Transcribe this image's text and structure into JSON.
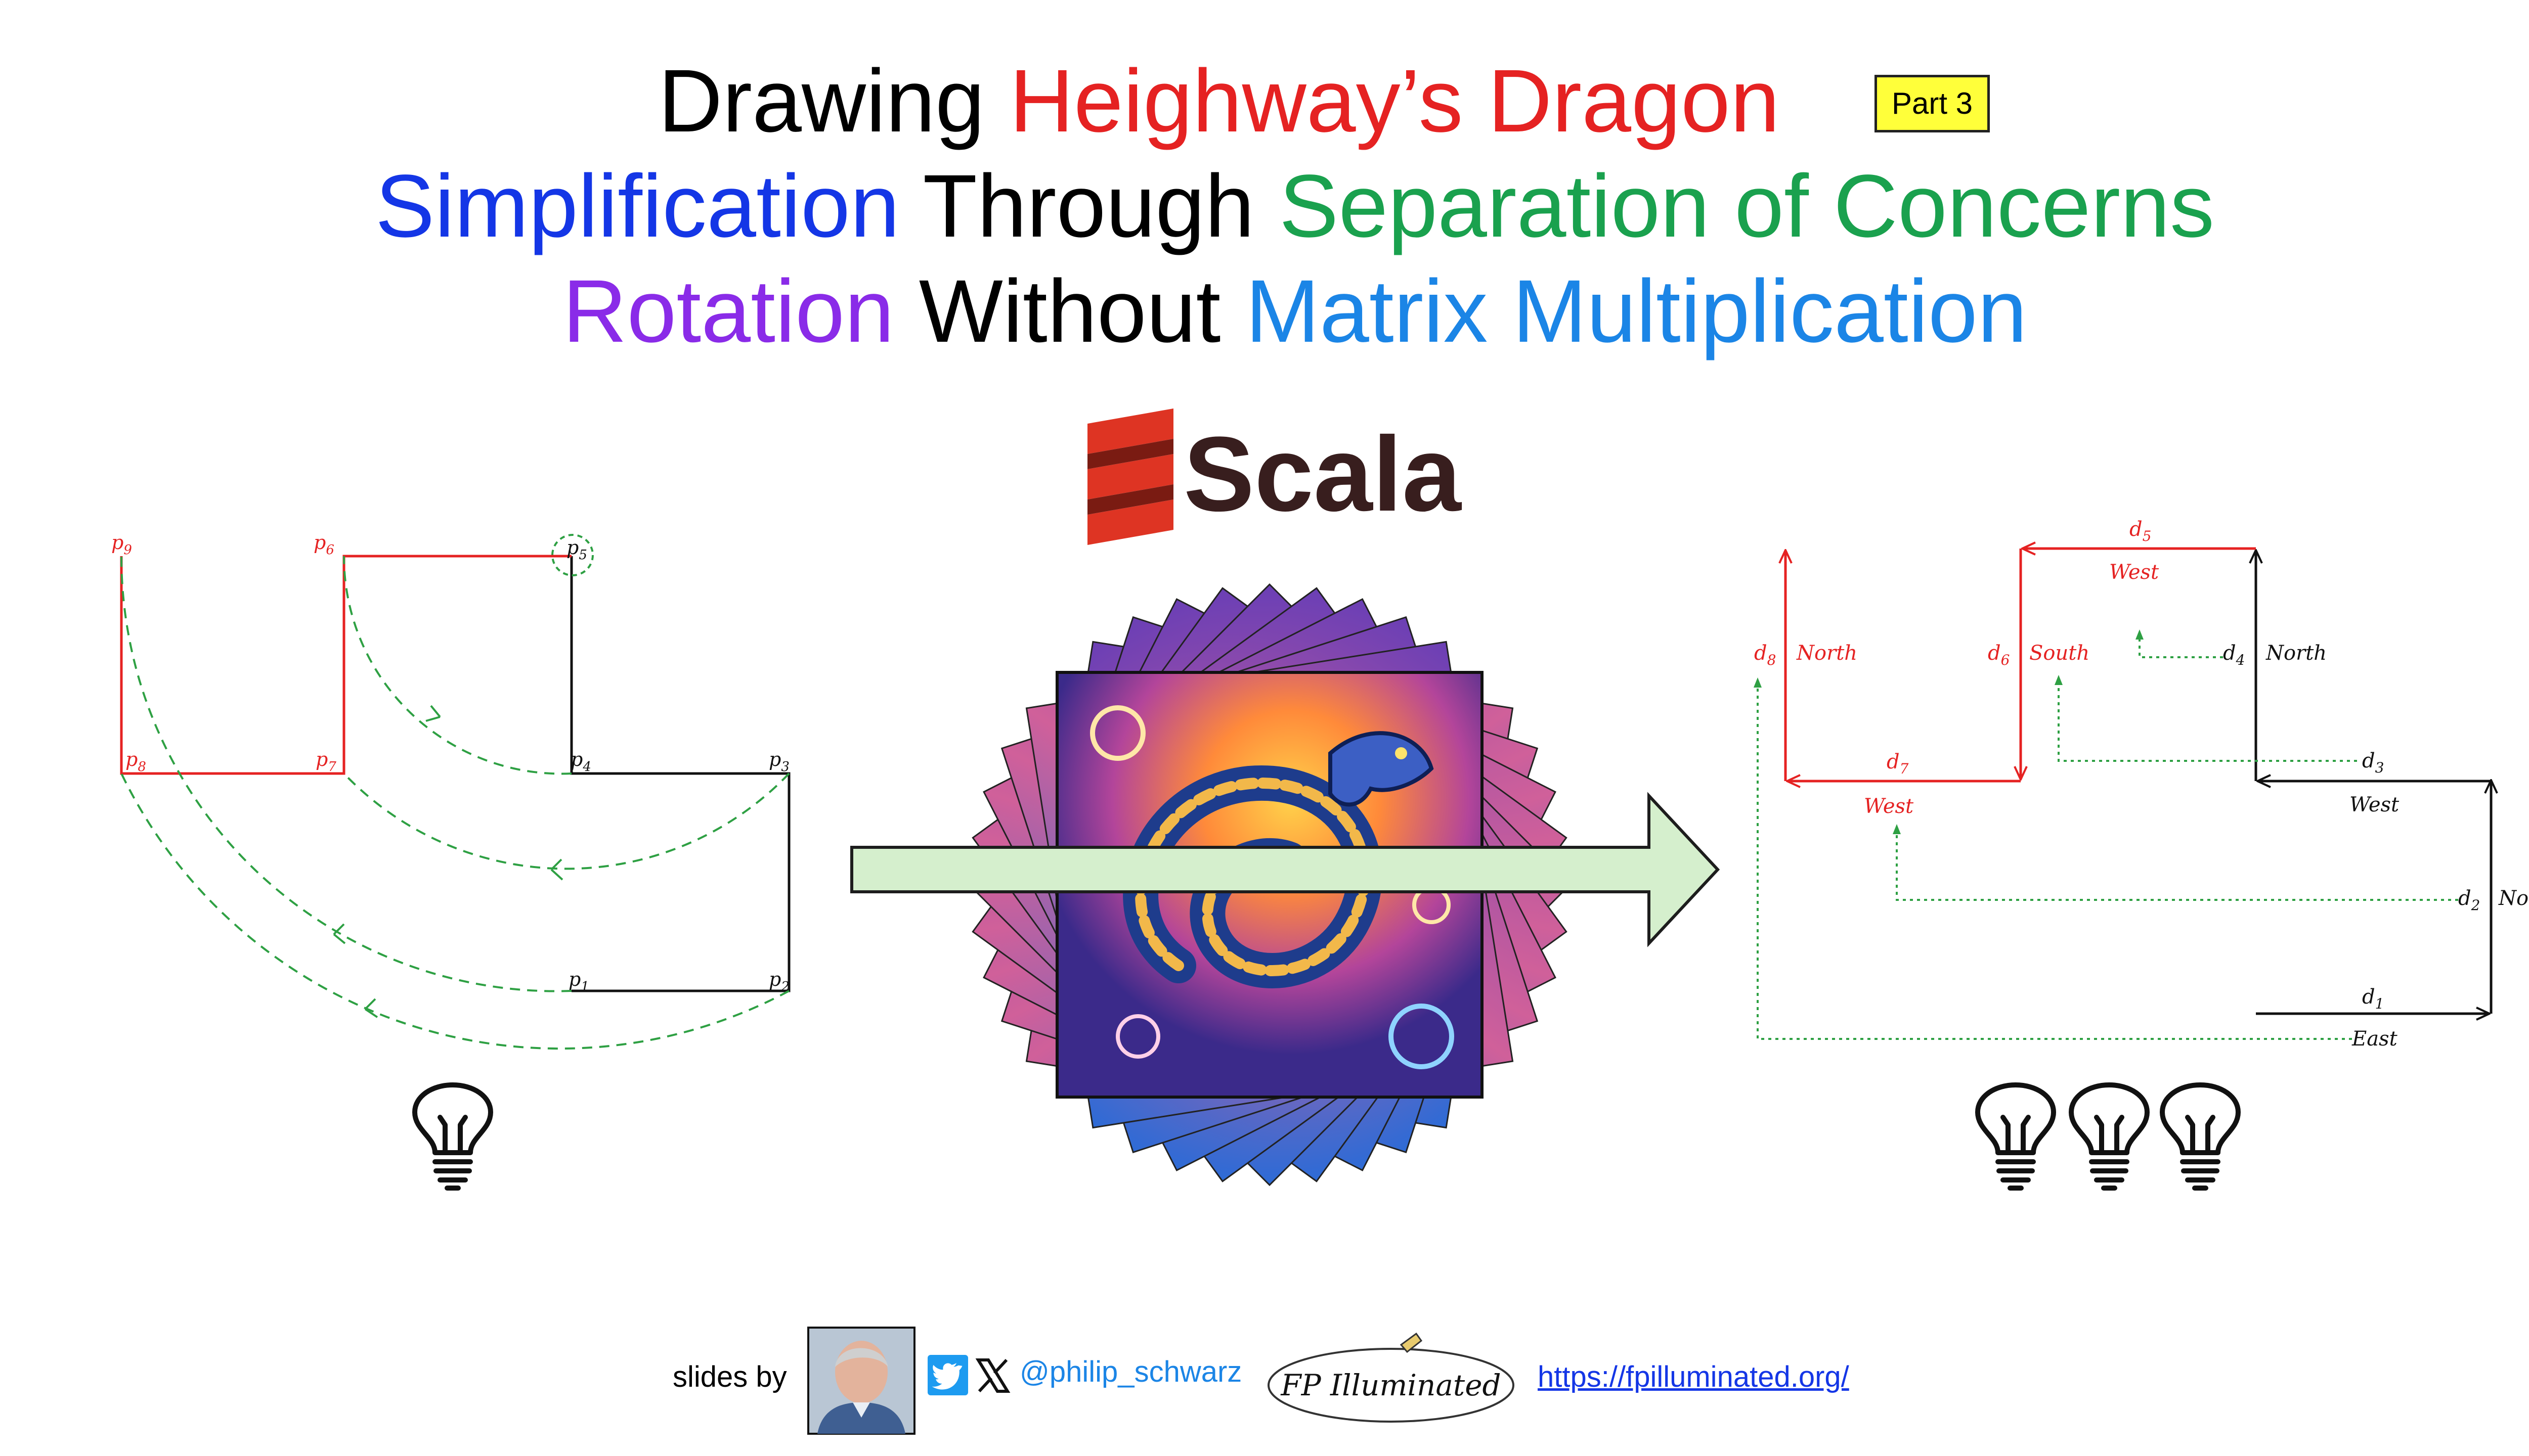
{
  "title": {
    "line1": [
      {
        "text": "Drawing ",
        "color": "#000000"
      },
      {
        "text": "Heighway’s Dragon",
        "color": "#e52222"
      }
    ],
    "badge": "Part 3",
    "line2": [
      {
        "text": "Simplification",
        "color": "#1436e6"
      },
      {
        "text": " Through ",
        "color": "#000000"
      },
      {
        "text": "Separation of Concerns",
        "color": "#1aa14e"
      }
    ],
    "line3": [
      {
        "text": "Rotation",
        "color": "#8a2be8"
      },
      {
        "text": " Without ",
        "color": "#000000"
      },
      {
        "text": "Matrix Multiplication",
        "color": "#1b85e6"
      }
    ]
  },
  "logo": {
    "text": "Scala",
    "color": "#381e1e",
    "mark_color": "#de3423"
  },
  "left_diagram": {
    "points": [
      "p",
      "p",
      "p",
      "p",
      "p",
      "p",
      "p",
      "p",
      "p"
    ],
    "subscripts": [
      "1",
      "2",
      "3",
      "4",
      "5",
      "6",
      "7",
      "8",
      "9"
    ]
  },
  "right_diagram": {
    "vectors": [
      {
        "name": "d",
        "sub": "1",
        "dir": "East"
      },
      {
        "name": "d",
        "sub": "2",
        "dir": "North"
      },
      {
        "name": "d",
        "sub": "3",
        "dir": "West"
      },
      {
        "name": "d",
        "sub": "4",
        "dir": "North"
      },
      {
        "name": "d",
        "sub": "5",
        "dir": "West"
      },
      {
        "name": "d",
        "sub": "6",
        "dir": "South"
      },
      {
        "name": "d",
        "sub": "7",
        "dir": "West"
      },
      {
        "name": "d",
        "sub": "8",
        "dir": "North"
      }
    ]
  },
  "lightbulbs": {
    "left_count": 1,
    "right_count": 3
  },
  "footer": {
    "slides_by": "slides by",
    "handle": "@philip_schwarz",
    "fp_logo_text": "FP Illuminated",
    "url": "https://fpilluminated.org/"
  },
  "colors": {
    "red": "#e52222",
    "green_dashed": "#2ea043",
    "arrow_fill": "#d5efcd"
  }
}
